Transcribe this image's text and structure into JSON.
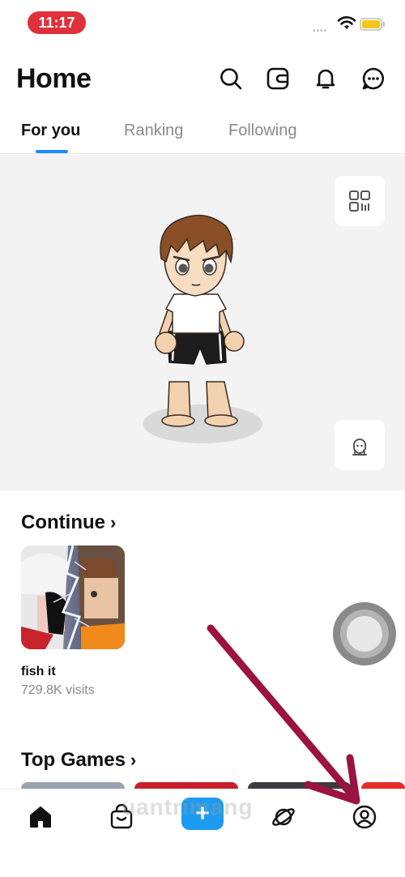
{
  "status_bar": {
    "time": "11:17",
    "signal": "••••"
  },
  "header": {
    "title": "Home"
  },
  "tabs": [
    {
      "label": "For you",
      "active": true
    },
    {
      "label": "Ranking",
      "active": false
    },
    {
      "label": "Following",
      "active": false
    }
  ],
  "continue_section": {
    "title": "Continue",
    "chevron": "›",
    "game": {
      "name": "fish it",
      "visits": "729.8K visits"
    }
  },
  "top_games_section": {
    "title": "Top Games",
    "chevron": "›"
  },
  "watermark": "uantrimang",
  "nav": [
    {
      "icon": "home-icon",
      "active": true
    },
    {
      "icon": "shop-bag-icon",
      "active": false
    },
    {
      "icon": "plus-icon",
      "label": "+",
      "active": false
    },
    {
      "icon": "planet-icon",
      "active": false
    },
    {
      "icon": "profile-icon",
      "active": false
    }
  ],
  "colors": {
    "accent": "#1a8cff",
    "create_button": "#1d9bf0",
    "time_pill": "#e0303a",
    "annotation_arrow": "#9b1340"
  }
}
